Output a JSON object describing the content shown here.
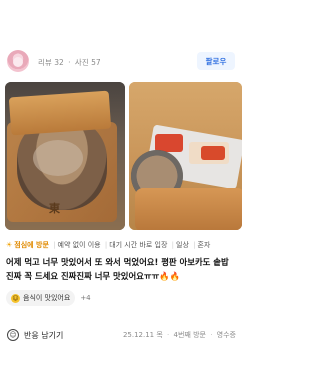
{
  "profile": {
    "review_label": "리뷰",
    "review_count": "32",
    "photo_label": "사진",
    "photo_count": "57",
    "follow_label": "팔로우"
  },
  "photos": {
    "photo1_caption": "東"
  },
  "tags": {
    "visit_time": "점심에 방문",
    "items": [
      "예약 없이 이용",
      "대기 시간 바로 입장",
      "일상",
      "혼자"
    ]
  },
  "review": {
    "text": "어제 먹고 너무 맛있어서 또 와서 먹었어요! 평판 아보카도 솥밥 진짜 꼭 드세요 진짜진짜 너무 맛있어요ㅠㅠ",
    "emoji": "🔥🔥"
  },
  "keywords": {
    "first": "음식이 맛있어요",
    "more": "+4"
  },
  "footer": {
    "reply_label": "반응 남기기",
    "date": "25.12.11 목",
    "visit_count": "4번째 방문",
    "receipt": "영수증"
  },
  "colors": {
    "follow_text": "#2f6fe0",
    "follow_bg": "#eef5ff",
    "visit_tag": "#e08a00"
  }
}
